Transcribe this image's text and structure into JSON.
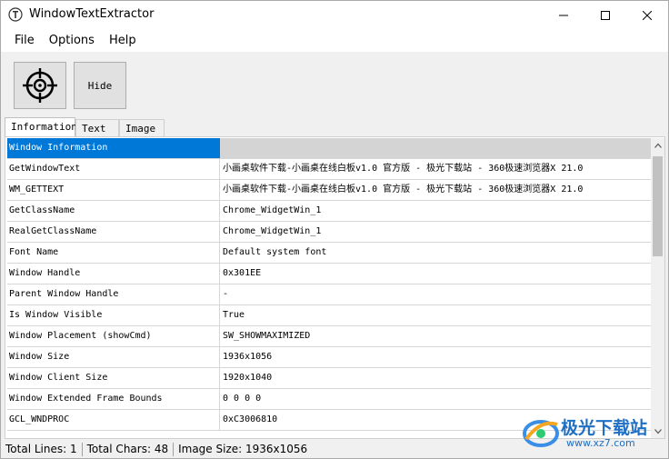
{
  "window": {
    "title": "WindowTextExtractor"
  },
  "menu": {
    "items": [
      "File",
      "Options",
      "Help"
    ]
  },
  "toolbar": {
    "hide_label": "Hide"
  },
  "tabs": [
    {
      "label": "Information",
      "active": true
    },
    {
      "label": "Text",
      "active": false
    },
    {
      "label": "Image",
      "active": false
    }
  ],
  "table": {
    "header": "Window Information",
    "rows": [
      {
        "key": "GetWindowText",
        "value": "小画桌软件下载-小画桌在线白板v1.0 官方版 - 极光下载站 - 360极速浏览器X 21.0"
      },
      {
        "key": "WM_GETTEXT",
        "value": "小画桌软件下载-小画桌在线白板v1.0 官方版 - 极光下载站 - 360极速浏览器X 21.0"
      },
      {
        "key": "GetClassName",
        "value": "Chrome_WidgetWin_1"
      },
      {
        "key": "RealGetClassName",
        "value": "Chrome_WidgetWin_1"
      },
      {
        "key": "Font Name",
        "value": "Default system font"
      },
      {
        "key": "Window Handle",
        "value": "0x301EE"
      },
      {
        "key": "Parent Window Handle",
        "value": "-"
      },
      {
        "key": "Is Window Visible",
        "value": "True"
      },
      {
        "key": "Window Placement (showCmd)",
        "value": "SW_SHOWMAXIMIZED"
      },
      {
        "key": "Window Size",
        "value": "1936x1056"
      },
      {
        "key": "Window Client Size",
        "value": "1920x1040"
      },
      {
        "key": "Window Extended Frame Bounds",
        "value": "0 0 0 0"
      },
      {
        "key": "GCL_WNDPROC",
        "value": "0xC3006810"
      }
    ]
  },
  "status": {
    "total_lines": "Total Lines: 1",
    "total_chars": "Total Chars: 48",
    "image_size": "Image Size: 1936x1056"
  },
  "watermark": {
    "title": "极光下载站",
    "url": "www.xz7.com"
  },
  "colors": {
    "selection": "#0078d7",
    "watermark": "#1f6fc4"
  }
}
